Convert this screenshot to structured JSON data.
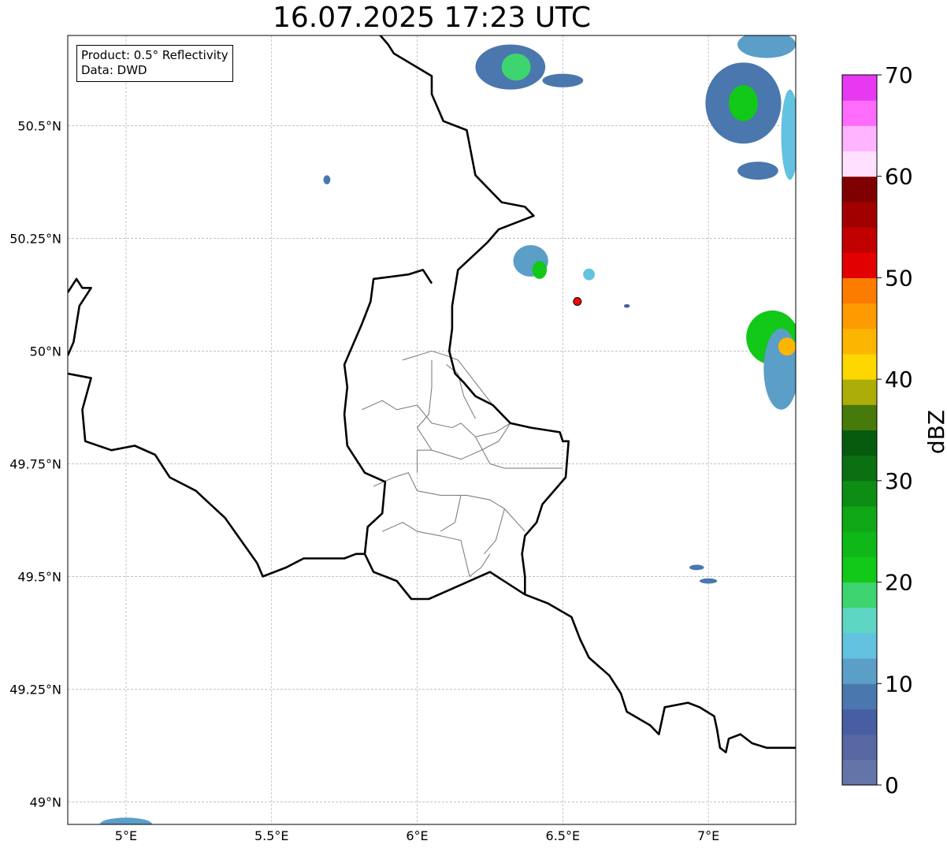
{
  "title": "16.07.2025 17:23 UTC",
  "info": {
    "product": "Product: 0.5° Reflectivity",
    "data": "Data: DWD"
  },
  "map": {
    "lon_range": [
      4.8,
      7.3
    ],
    "lat_range": [
      48.95,
      50.7
    ],
    "x_ticks": [
      {
        "value": 5.0,
        "label": "5°E"
      },
      {
        "value": 5.5,
        "label": "5.5°E"
      },
      {
        "value": 6.0,
        "label": "6°E"
      },
      {
        "value": 6.5,
        "label": "6.5°E"
      },
      {
        "value": 7.0,
        "label": "7°E"
      }
    ],
    "y_ticks": [
      {
        "value": 49.0,
        "label": "49°N"
      },
      {
        "value": 49.25,
        "label": "49.25°N"
      },
      {
        "value": 49.5,
        "label": "49.5°N"
      },
      {
        "value": 49.75,
        "label": "49.75°N"
      },
      {
        "value": 50.0,
        "label": "50°N"
      },
      {
        "value": 50.25,
        "label": "50.25°N"
      },
      {
        "value": 50.5,
        "label": "50.5°N"
      }
    ],
    "grid": true,
    "radar_site": {
      "lon": 6.55,
      "lat": 50.11,
      "color": "#ff0000"
    }
  },
  "colorbar": {
    "label": "dBZ",
    "min": 0,
    "max": 70,
    "ticks": [
      {
        "value": 0,
        "label": "0"
      },
      {
        "value": 10,
        "label": "10"
      },
      {
        "value": 20,
        "label": "20"
      },
      {
        "value": 30,
        "label": "30"
      },
      {
        "value": 40,
        "label": "40"
      },
      {
        "value": 50,
        "label": "50"
      },
      {
        "value": 60,
        "label": "60"
      },
      {
        "value": 70,
        "label": "70"
      }
    ],
    "colors": [
      "#6574a8",
      "#5866a2",
      "#475ea2",
      "#4a77ad",
      "#5b9ec8",
      "#63c2df",
      "#5ed6c3",
      "#3ed46f",
      "#12c818",
      "#10b718",
      "#10a716",
      "#0e8d14",
      "#0a7012",
      "#075b0e",
      "#47790b",
      "#acad07",
      "#fed600",
      "#fcb600",
      "#fd9b00",
      "#fc7c00",
      "#e20000",
      "#c10000",
      "#a10000",
      "#7f0000",
      "#ffe0ff",
      "#ffb4ff",
      "#ff6cfc",
      "#e739f2"
    ]
  },
  "echoes": [
    {
      "lon": 6.32,
      "lat": 50.63,
      "rx": 0.12,
      "ry": 0.05,
      "level": 3
    },
    {
      "lon": 6.34,
      "lat": 50.63,
      "rx": 0.05,
      "ry": 0.03,
      "level": 7
    },
    {
      "lon": 6.5,
      "lat": 50.6,
      "rx": 0.07,
      "ry": 0.015,
      "level": 3
    },
    {
      "lon": 7.2,
      "lat": 50.68,
      "rx": 0.1,
      "ry": 0.03,
      "level": 4
    },
    {
      "lon": 7.12,
      "lat": 50.55,
      "rx": 0.13,
      "ry": 0.09,
      "level": 3
    },
    {
      "lon": 7.12,
      "lat": 50.55,
      "rx": 0.05,
      "ry": 0.04,
      "level": 8
    },
    {
      "lon": 7.17,
      "lat": 50.4,
      "rx": 0.07,
      "ry": 0.02,
      "level": 3
    },
    {
      "lon": 7.28,
      "lat": 50.48,
      "rx": 0.03,
      "ry": 0.1,
      "level": 5
    },
    {
      "lon": 6.39,
      "lat": 50.2,
      "rx": 0.06,
      "ry": 0.035,
      "level": 4
    },
    {
      "lon": 6.42,
      "lat": 50.18,
      "rx": 0.025,
      "ry": 0.02,
      "level": 8
    },
    {
      "lon": 6.59,
      "lat": 50.17,
      "rx": 0.02,
      "ry": 0.013,
      "level": 5
    },
    {
      "lon": 5.69,
      "lat": 50.38,
      "rx": 0.012,
      "ry": 0.01,
      "level": 3
    },
    {
      "lon": 7.22,
      "lat": 50.03,
      "rx": 0.09,
      "ry": 0.06,
      "level": 8
    },
    {
      "lon": 7.25,
      "lat": 49.96,
      "rx": 0.06,
      "ry": 0.09,
      "level": 4
    },
    {
      "lon": 7.27,
      "lat": 50.01,
      "rx": 0.03,
      "ry": 0.02,
      "level": 17
    },
    {
      "lon": 6.96,
      "lat": 49.52,
      "rx": 0.025,
      "ry": 0.006,
      "level": 3
    },
    {
      "lon": 7.0,
      "lat": 49.49,
      "rx": 0.03,
      "ry": 0.006,
      "level": 3
    },
    {
      "lon": 5.0,
      "lat": 48.95,
      "rx": 0.09,
      "ry": 0.015,
      "level": 4
    },
    {
      "lon": 6.72,
      "lat": 50.1,
      "rx": 0.01,
      "ry": 0.004,
      "level": 2
    }
  ],
  "borders": {
    "country": [
      [
        [
          5.86,
          50.71
        ],
        [
          5.9,
          50.68
        ],
        [
          5.92,
          50.66
        ],
        [
          6.05,
          50.61
        ],
        [
          6.05,
          50.57
        ],
        [
          6.09,
          50.51
        ],
        [
          6.17,
          50.49
        ],
        [
          6.2,
          50.39
        ],
        [
          6.29,
          50.33
        ],
        [
          6.37,
          50.32
        ],
        [
          6.4,
          50.3
        ],
        [
          6.28,
          50.27
        ],
        [
          6.24,
          50.24
        ],
        [
          6.19,
          50.21
        ],
        [
          6.14,
          50.18
        ],
        [
          6.13,
          50.14
        ],
        [
          6.12,
          50.1
        ],
        [
          6.12,
          50.05
        ],
        [
          6.11,
          50.0
        ],
        [
          6.13,
          49.95
        ],
        [
          6.16,
          49.93
        ],
        [
          6.2,
          49.9
        ],
        [
          6.26,
          49.88
        ],
        [
          6.32,
          49.84
        ],
        [
          6.39,
          49.83
        ],
        [
          6.49,
          49.82
        ],
        [
          6.5,
          49.8
        ],
        [
          6.52,
          49.8
        ],
        [
          6.51,
          49.72
        ],
        [
          6.43,
          49.66
        ],
        [
          6.41,
          49.62
        ],
        [
          6.37,
          49.59
        ],
        [
          6.36,
          49.55
        ],
        [
          6.37,
          49.5
        ],
        [
          6.37,
          49.46
        ],
        [
          6.25,
          49.51
        ],
        [
          6.11,
          49.47
        ],
        [
          6.04,
          49.45
        ],
        [
          5.98,
          49.45
        ],
        [
          5.93,
          49.49
        ],
        [
          5.85,
          49.51
        ],
        [
          5.82,
          49.55
        ],
        [
          5.83,
          49.61
        ],
        [
          5.88,
          49.64
        ],
        [
          5.89,
          49.71
        ],
        [
          5.82,
          49.73
        ],
        [
          5.76,
          49.79
        ],
        [
          5.75,
          49.86
        ],
        [
          5.76,
          49.92
        ],
        [
          5.75,
          49.97
        ],
        [
          5.81,
          50.06
        ],
        [
          5.84,
          50.11
        ],
        [
          5.85,
          50.16
        ],
        [
          5.97,
          50.17
        ],
        [
          6.02,
          50.18
        ],
        [
          6.05,
          50.15
        ]
      ],
      [
        [
          4.8,
          49.95
        ],
        [
          4.88,
          49.94
        ],
        [
          4.85,
          49.87
        ],
        [
          4.86,
          49.8
        ],
        [
          4.95,
          49.78
        ],
        [
          5.03,
          49.79
        ],
        [
          5.1,
          49.77
        ],
        [
          5.15,
          49.72
        ],
        [
          5.24,
          49.69
        ],
        [
          5.29,
          49.66
        ],
        [
          5.34,
          49.63
        ],
        [
          5.45,
          49.53
        ],
        [
          5.47,
          49.5
        ],
        [
          5.55,
          49.52
        ],
        [
          5.61,
          49.54
        ],
        [
          5.7,
          49.54
        ],
        [
          5.75,
          49.54
        ],
        [
          5.79,
          49.55
        ],
        [
          5.82,
          49.55
        ]
      ],
      [
        [
          6.37,
          49.46
        ],
        [
          6.45,
          49.44
        ],
        [
          6.53,
          49.41
        ],
        [
          6.56,
          49.36
        ],
        [
          6.59,
          49.32
        ],
        [
          6.66,
          49.28
        ],
        [
          6.7,
          49.24
        ],
        [
          6.72,
          49.2
        ],
        [
          6.8,
          49.17
        ],
        [
          6.83,
          49.15
        ],
        [
          6.85,
          49.21
        ],
        [
          6.93,
          49.22
        ],
        [
          6.97,
          49.21
        ],
        [
          7.02,
          49.19
        ],
        [
          7.03,
          49.16
        ],
        [
          7.04,
          49.12
        ],
        [
          7.06,
          49.11
        ],
        [
          7.07,
          49.14
        ],
        [
          7.11,
          49.15
        ],
        [
          7.15,
          49.13
        ],
        [
          7.2,
          49.12
        ],
        [
          7.25,
          49.12
        ],
        [
          7.3,
          49.12
        ]
      ],
      [
        [
          4.8,
          50.13
        ],
        [
          4.83,
          50.16
        ],
        [
          4.85,
          50.14
        ],
        [
          4.88,
          50.14
        ],
        [
          4.84,
          50.1
        ],
        [
          4.83,
          50.06
        ],
        [
          4.82,
          50.02
        ],
        [
          4.8,
          49.99
        ]
      ]
    ],
    "canton": [
      [
        [
          5.81,
          49.87
        ],
        [
          5.88,
          49.89
        ],
        [
          5.93,
          49.87
        ],
        [
          6.0,
          49.88
        ],
        [
          6.05,
          49.84
        ],
        [
          6.12,
          49.83
        ],
        [
          6.15,
          49.84
        ],
        [
          6.2,
          49.81
        ],
        [
          6.27,
          49.82
        ],
        [
          6.32,
          49.84
        ]
      ],
      [
        [
          5.95,
          49.98
        ],
        [
          6.0,
          49.99
        ],
        [
          6.05,
          50.0
        ],
        [
          6.1,
          49.99
        ],
        [
          6.14,
          49.98
        ],
        [
          6.2,
          49.93
        ],
        [
          6.26,
          49.88
        ]
      ],
      [
        [
          6.05,
          49.98
        ],
        [
          6.05,
          49.92
        ],
        [
          6.04,
          49.86
        ],
        [
          6.0,
          49.83
        ]
      ],
      [
        [
          6.1,
          49.97
        ],
        [
          6.14,
          49.95
        ],
        [
          6.16,
          49.9
        ],
        [
          6.2,
          49.85
        ]
      ],
      [
        [
          6.0,
          49.83
        ],
        [
          6.05,
          49.78
        ],
        [
          6.15,
          49.76
        ],
        [
          6.22,
          49.78
        ],
        [
          6.28,
          49.8
        ],
        [
          6.32,
          49.84
        ]
      ],
      [
        [
          6.2,
          49.81
        ],
        [
          6.25,
          49.75
        ],
        [
          6.3,
          49.74
        ],
        [
          6.4,
          49.74
        ],
        [
          6.5,
          49.74
        ]
      ],
      [
        [
          5.85,
          49.7
        ],
        [
          5.92,
          49.72
        ],
        [
          5.97,
          49.73
        ],
        [
          6.0,
          49.69
        ],
        [
          6.08,
          49.68
        ],
        [
          6.17,
          49.68
        ],
        [
          6.25,
          49.67
        ],
        [
          6.3,
          49.65
        ],
        [
          6.37,
          49.6
        ]
      ],
      [
        [
          6.0,
          49.73
        ],
        [
          6.0,
          49.78
        ],
        [
          6.05,
          49.78
        ]
      ],
      [
        [
          6.3,
          49.65
        ],
        [
          6.27,
          49.58
        ],
        [
          6.23,
          49.55
        ]
      ],
      [
        [
          5.88,
          49.6
        ],
        [
          5.95,
          49.62
        ],
        [
          6.0,
          49.6
        ],
        [
          6.08,
          49.59
        ],
        [
          6.15,
          49.58
        ]
      ],
      [
        [
          6.15,
          49.68
        ],
        [
          6.13,
          49.62
        ],
        [
          6.08,
          49.6
        ]
      ],
      [
        [
          6.15,
          49.58
        ],
        [
          6.18,
          49.5
        ],
        [
          6.22,
          49.52
        ],
        [
          6.25,
          49.55
        ]
      ]
    ]
  }
}
